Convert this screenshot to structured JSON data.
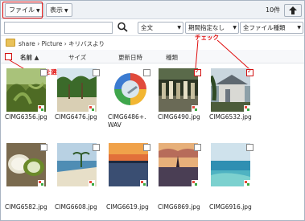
{
  "toolbar": {
    "file_label": "ファイル",
    "view_label": "表示",
    "count": "10件"
  },
  "filters": {
    "scope_selected": "全文",
    "period_selected": "期間指定なし",
    "type_selected": "全ファイル種類"
  },
  "breadcrumb": [
    "share",
    "Picture",
    "キリバスより"
  ],
  "columns": {
    "name": "名前",
    "size": "サイズ",
    "modified": "更新日時",
    "kind": "種類"
  },
  "annotations": {
    "select_all": "すべてを選択・解除",
    "check": "チェック"
  },
  "files": [
    {
      "name": "CIMG6356.jpg",
      "checked": false
    },
    {
      "name": "CIMG6476.jpg",
      "checked": false
    },
    {
      "name": "CIMG6486+.\nWAV",
      "checked": false
    },
    {
      "name": "CIMG6490.jpg",
      "checked": true
    },
    {
      "name": "CIMG6532.jpg",
      "checked": true
    },
    {
      "name": "CIMG6582.jpg",
      "checked": false
    },
    {
      "name": "CIMG6608.jpg",
      "checked": false
    },
    {
      "name": "CIMG6619.jpg",
      "checked": false
    },
    {
      "name": "CIMG6869.jpg",
      "checked": false
    },
    {
      "name": "CIMG6916.jpg",
      "checked": false
    }
  ],
  "colors": {
    "annotation_red": "#e01010",
    "toolbar_bg": "#eef1f5"
  }
}
